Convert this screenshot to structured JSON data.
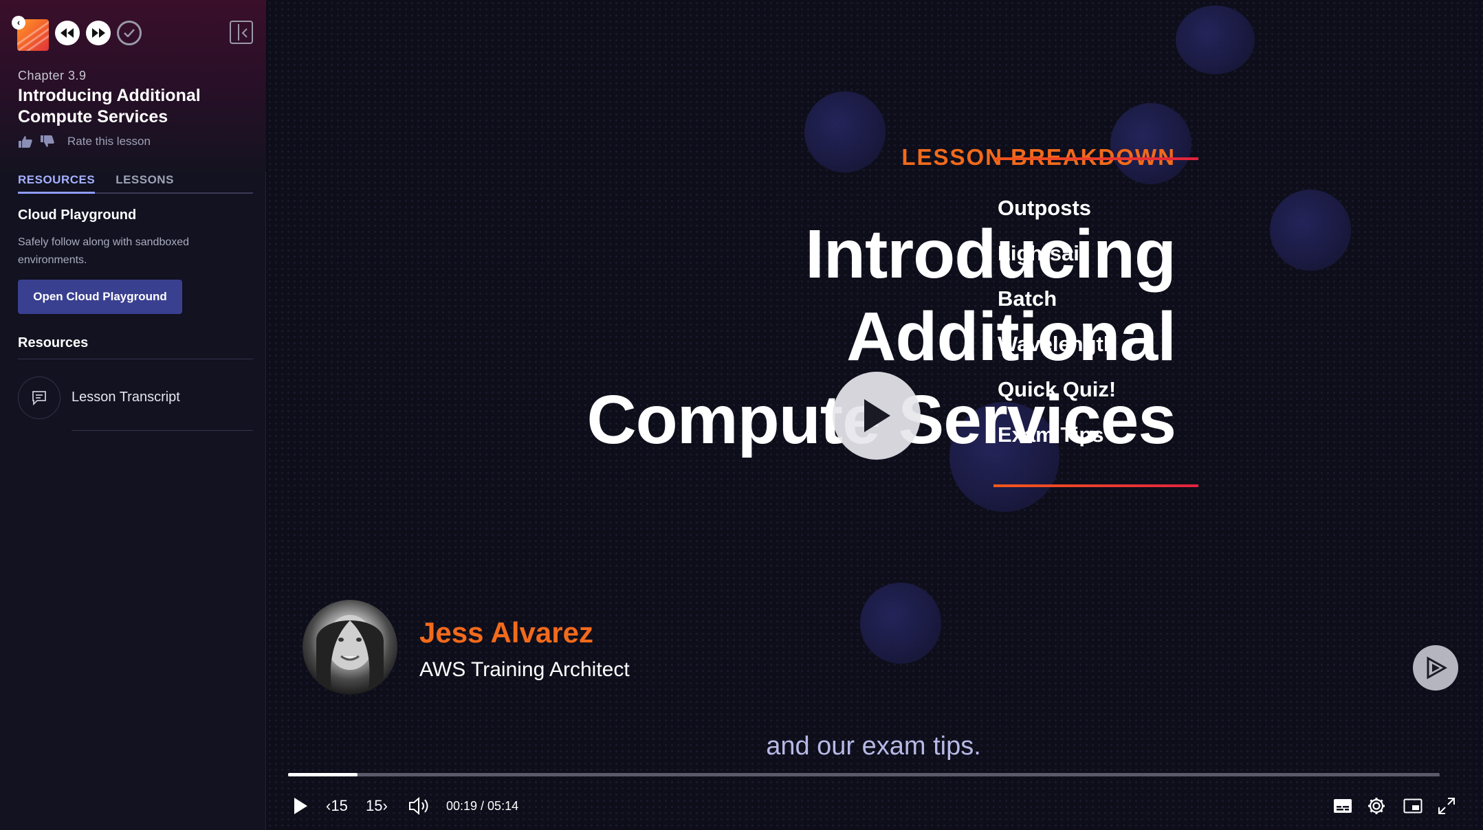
{
  "sidebar": {
    "chapter": "Chapter 3.9",
    "title": "Introducing Additional Compute Services",
    "rate_label": "Rate this lesson",
    "tabs": [
      {
        "label": "RESOURCES",
        "active": true
      },
      {
        "label": "LESSONS",
        "active": false
      }
    ],
    "cloud_playground": {
      "title": "Cloud Playground",
      "description": "Safely follow along with sandboxed environments.",
      "button_label": "Open Cloud Playground"
    },
    "resources": {
      "title": "Resources",
      "items": [
        {
          "label": "Lesson Transcript",
          "icon": "transcript-icon"
        }
      ]
    }
  },
  "video": {
    "slide": {
      "breakdown_label": "LESSON BREAKDOWN",
      "headline_lines": [
        "Introducing",
        "Additional",
        "Compute Services"
      ],
      "topics": [
        "Outposts",
        "Lightsail",
        "Batch",
        "Wavelength",
        "Quick Quiz!",
        "Exam Tips"
      ]
    },
    "presenter": {
      "name": "Jess Alvarez",
      "role": "AWS Training Architect"
    },
    "caption": "and our exam tips.",
    "controls": {
      "skip_back_label": "15",
      "skip_forward_label": "15",
      "current_time": "00:19",
      "duration": "05:14",
      "time_display": "00:19 / 05:14",
      "progress_fraction": 0.06
    }
  },
  "colors": {
    "accent_orange": "#f26a1b",
    "tab_active": "#a6b0ff",
    "button_bg": "#3a4090",
    "caption": "#b7b9e6"
  }
}
